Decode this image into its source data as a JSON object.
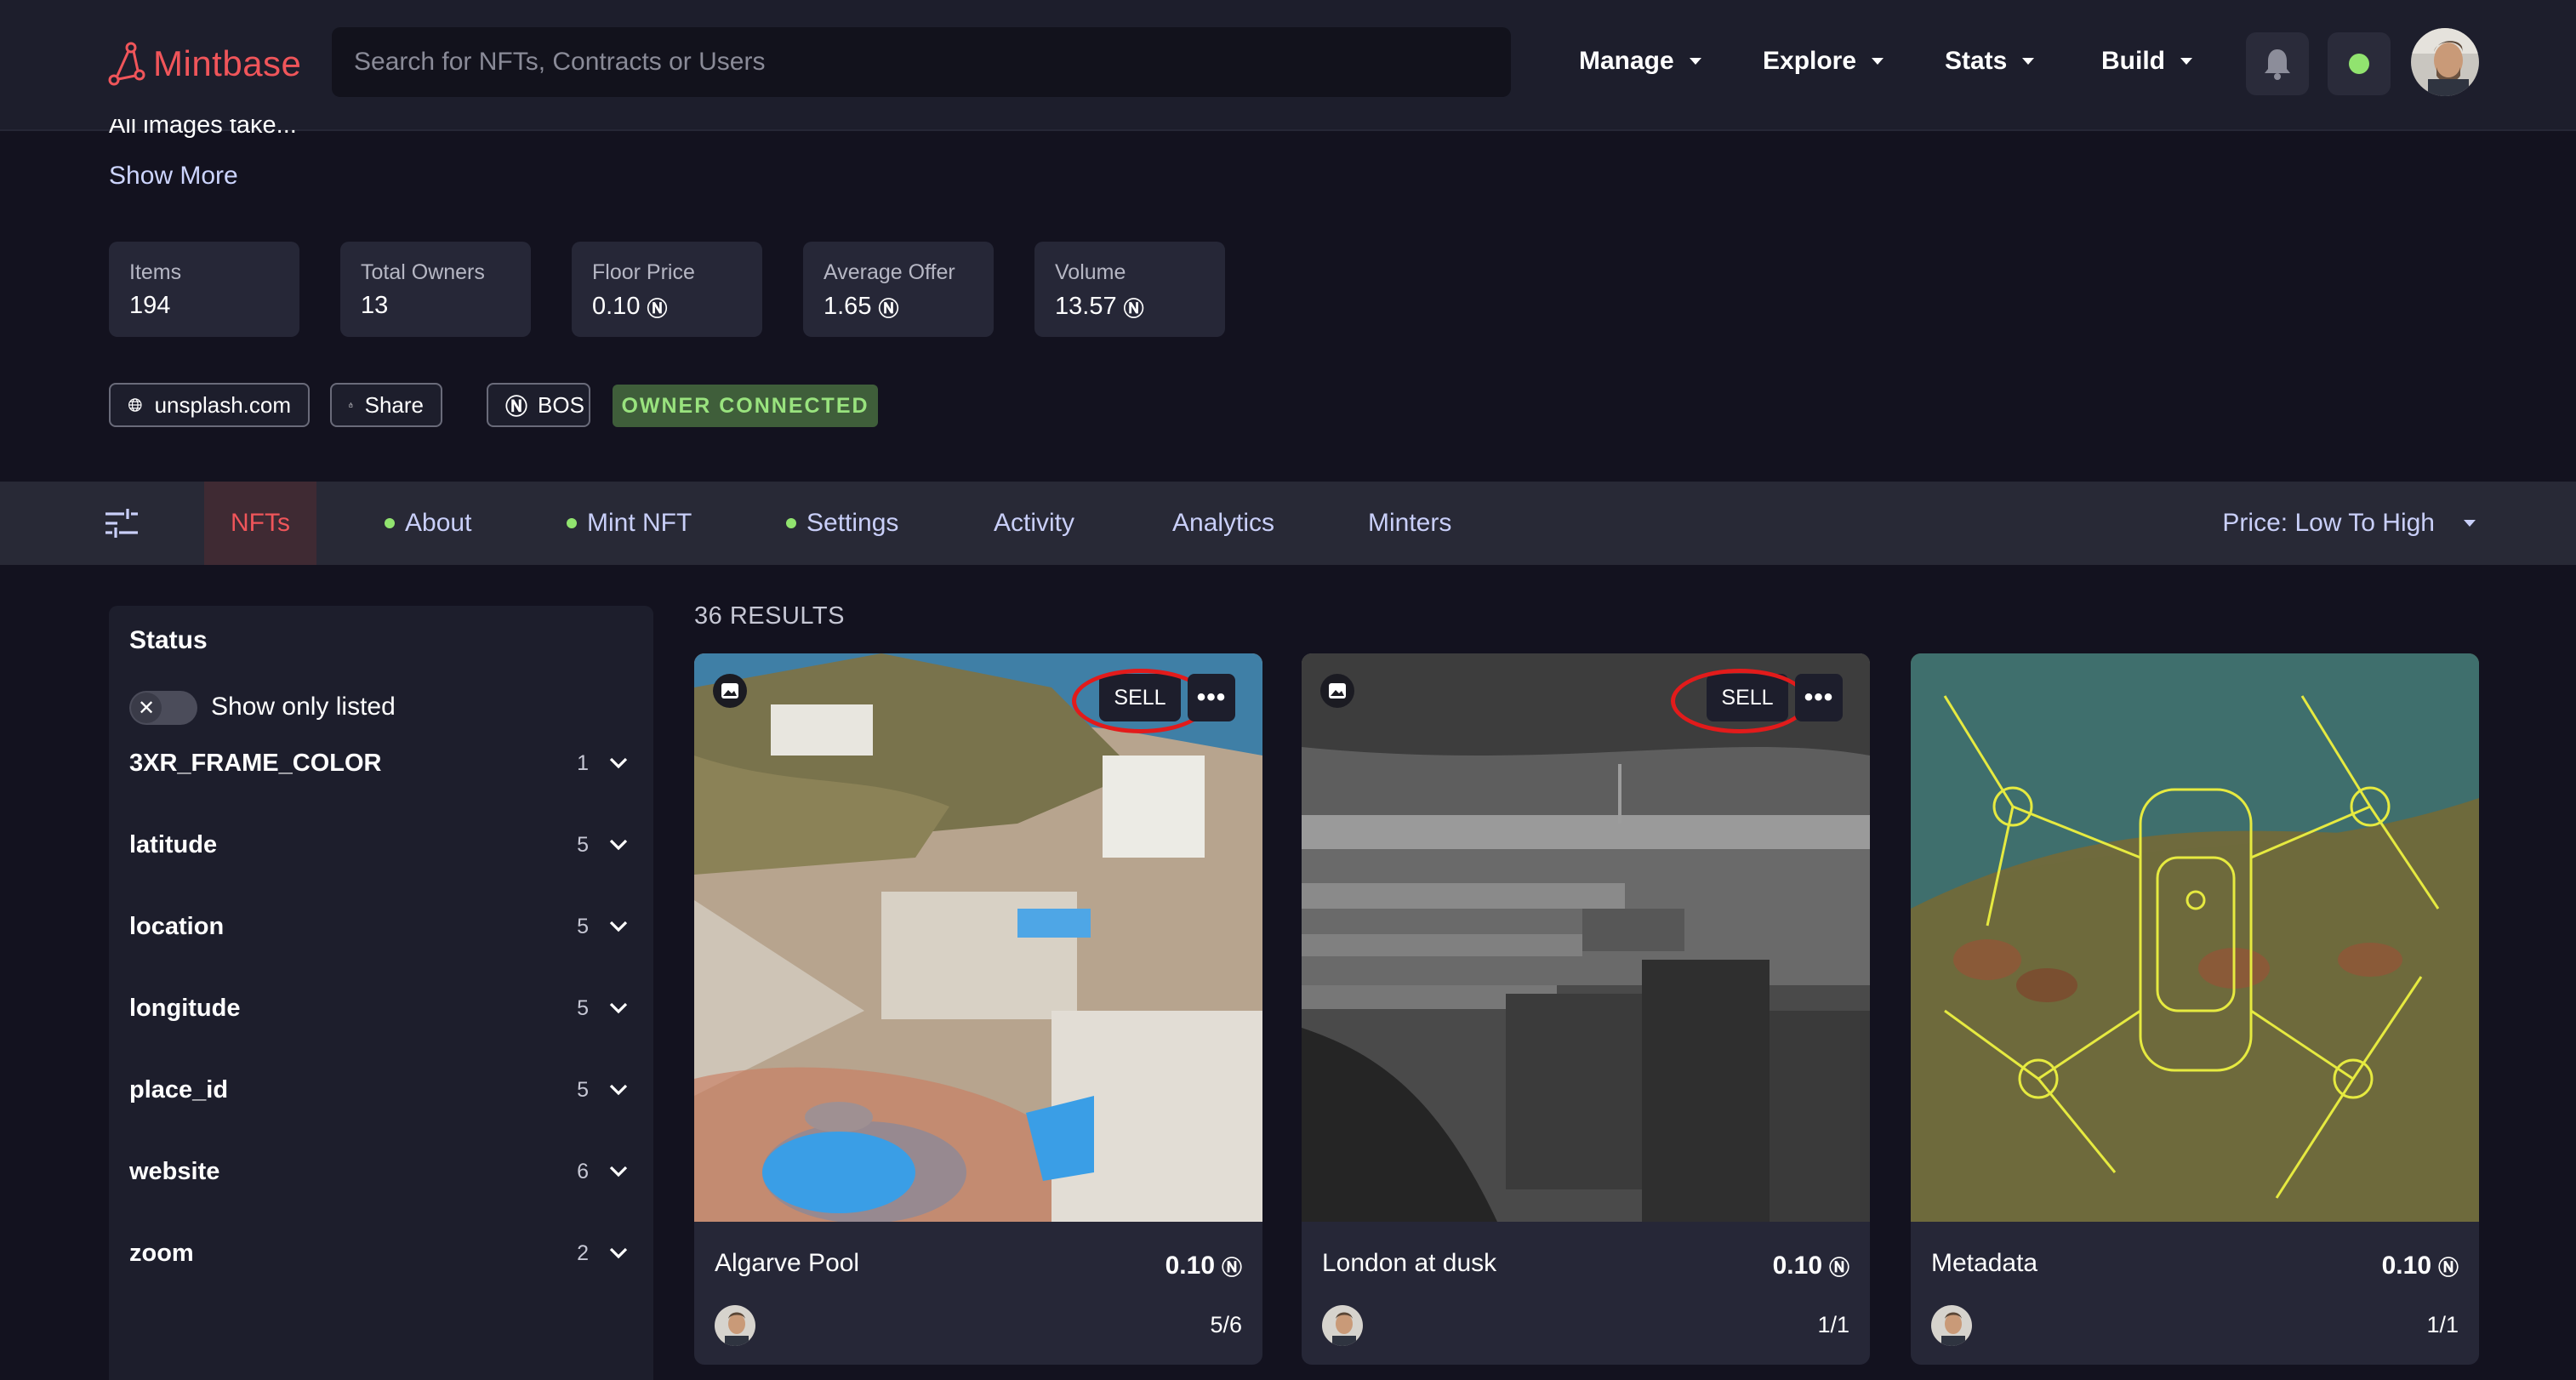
{
  "header": {
    "brand": "Mintbase",
    "search_placeholder": "Search for NFTs, Contracts or Users",
    "menus": [
      "Manage",
      "Explore",
      "Stats",
      "Build"
    ]
  },
  "collection": {
    "description_cut": "All images take...",
    "show_more": "Show More",
    "stats": [
      {
        "label": "Items",
        "value": "194",
        "near": false
      },
      {
        "label": "Total Owners",
        "value": "13",
        "near": false
      },
      {
        "label": "Floor Price",
        "value": "0.10",
        "near": true
      },
      {
        "label": "Average Offer",
        "value": "1.65",
        "near": true
      },
      {
        "label": "Volume",
        "value": "13.57",
        "near": true
      }
    ],
    "website": "unsplash.com",
    "share": "Share",
    "bos": "BOS",
    "owner_badge": "OWNER CONNECTED"
  },
  "tabs": {
    "items": [
      "NFTs",
      "About",
      "Mint NFT",
      "Settings",
      "Activity",
      "Analytics",
      "Minters"
    ],
    "sort": "Price: Low To High"
  },
  "sidebar": {
    "title": "Status",
    "toggle_label": "Show only listed",
    "attributes": [
      {
        "name": "3XR_FRAME_COLOR",
        "count": "1"
      },
      {
        "name": "latitude",
        "count": "5"
      },
      {
        "name": "location",
        "count": "5"
      },
      {
        "name": "longitude",
        "count": "5"
      },
      {
        "name": "place_id",
        "count": "5"
      },
      {
        "name": "website",
        "count": "6"
      },
      {
        "name": "zoom",
        "count": "2"
      }
    ]
  },
  "results": {
    "count_label": "36 RESULTS",
    "cards": [
      {
        "title": "Algarve Pool",
        "price": "0.10",
        "edition": "5/6",
        "sell": "SELL",
        "more": "•••"
      },
      {
        "title": "London at dusk",
        "price": "0.10",
        "edition": "1/1",
        "sell": "SELL",
        "more": "•••"
      },
      {
        "title": "Metadata",
        "price": "0.10",
        "edition": "1/1"
      }
    ]
  },
  "near_symbol": "Ⓝ",
  "colors": {
    "brand": "#f0555a",
    "accent_green": "#91e36f",
    "highlight_ring": "#e21b1b"
  }
}
